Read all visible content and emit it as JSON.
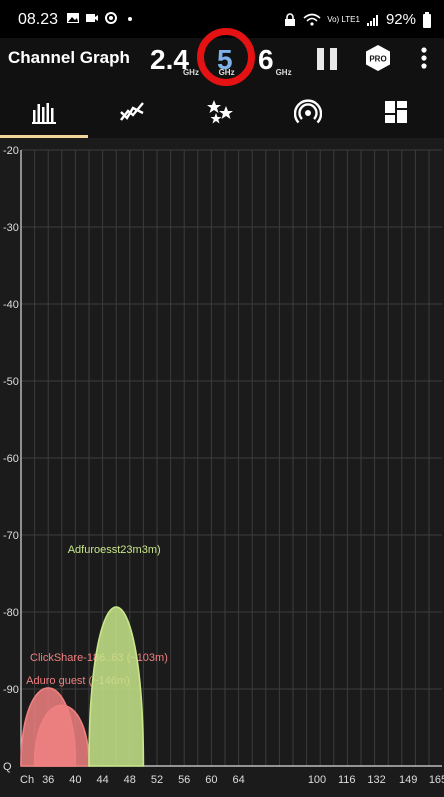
{
  "status": {
    "time": "08.23",
    "battery": "92%",
    "network": "Vo) LTE1"
  },
  "app": {
    "title": "Channel Graph"
  },
  "bands": [
    {
      "label": "2.4",
      "unit": "GHz"
    },
    {
      "label": "5",
      "unit": "GHz",
      "selected": true
    },
    {
      "label": "6",
      "unit": "GHz"
    }
  ],
  "actions": {
    "pro_label": "PRO"
  },
  "tabs": [
    {
      "icon": "channel-graph-icon",
      "selected": true
    },
    {
      "icon": "time-graph-icon"
    },
    {
      "icon": "channel-rating-icon"
    },
    {
      "icon": "access-points-icon"
    },
    {
      "icon": "dashboard-icon"
    }
  ],
  "colors": {
    "accent": "#f2d59a",
    "highlight_ring": "#e41212",
    "selected_band": "#7fb2e8",
    "network_green": "#c8e68a",
    "network_red": "#f08080"
  },
  "chart_data": {
    "type": "area",
    "ylim": [
      -100,
      -20
    ],
    "y_ticks": [
      "-20",
      "-30",
      "-40",
      "-50",
      "-60",
      "-70",
      "-80",
      "-90",
      "Q"
    ],
    "x_axis_label": "Ch",
    "x_ticks": [
      "36",
      "40",
      "44",
      "48",
      "52",
      "56",
      "60",
      "64",
      "100",
      "116",
      "132",
      "149",
      "165"
    ],
    "networks": [
      {
        "name": "Aduro guest (~23m)",
        "overlay_text": "Adfuroesst23m3m)",
        "channel_center": 46,
        "channel_width": 20,
        "signal": -73,
        "color": "#c8e68a"
      },
      {
        "name": "ClickShare-186..63 (~103m)",
        "overlay_text": "ClickShare-186..63 (~103m)",
        "channel_center": 36,
        "channel_width": 20,
        "signal": -87,
        "color": "#f08080"
      },
      {
        "name": "Aduro guest (~146m)",
        "overlay_text": "Aduro guest (~146m)",
        "channel_center": 38,
        "channel_width": 20,
        "signal": -90,
        "color": "#f08080"
      }
    ]
  }
}
